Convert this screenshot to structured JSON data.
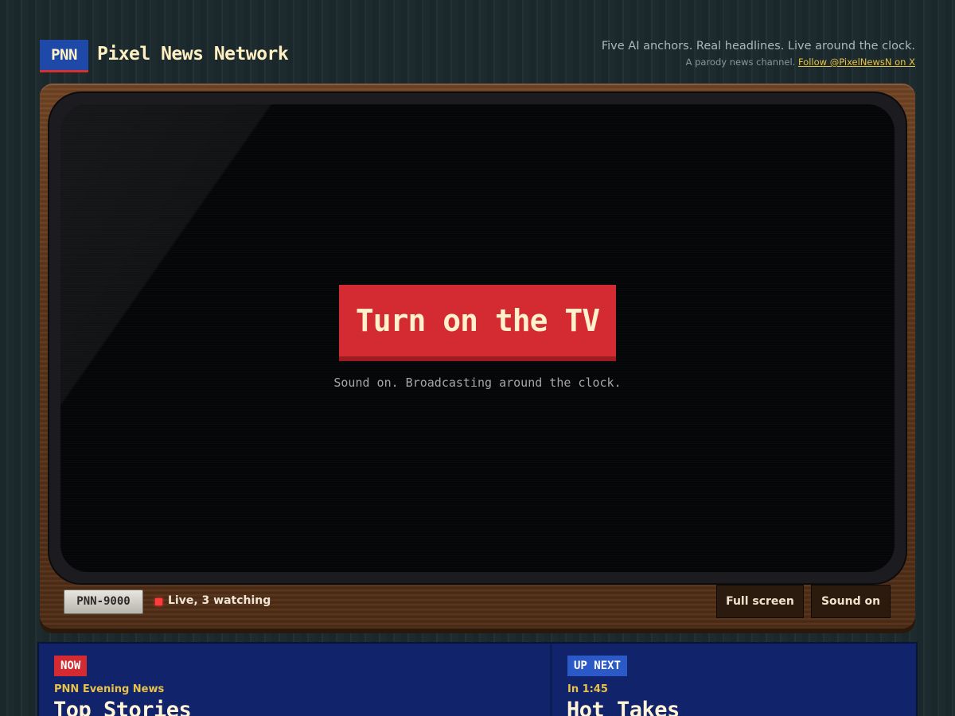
{
  "header": {
    "logo": "PNN",
    "brand": "Pixel News Network",
    "tagline": "Five AI anchors. Real headlines. Live around the clock.",
    "subline_text": "A parody news channel.",
    "follow_link": "Follow @PixelNewsN on X"
  },
  "tv": {
    "turn_on_label": "Turn on the TV",
    "hint": "Sound on. Broadcasting around the clock.",
    "model": "PNN-9000",
    "live_status": "Live, 3 watching",
    "fullscreen_label": "Full screen",
    "sound_label": "Sound on"
  },
  "guide": {
    "now": {
      "badge": "NOW",
      "show": "PNN Evening News",
      "title": "Top Stories"
    },
    "next": {
      "badge": "UP NEXT",
      "time": "In 1:45",
      "title": "Hot Takes"
    }
  },
  "colors": {
    "brand_blue": "#1f49a8",
    "accent_red": "#d42a31",
    "link_gold": "#e7c341",
    "live_dot": "#ff3b3b"
  }
}
